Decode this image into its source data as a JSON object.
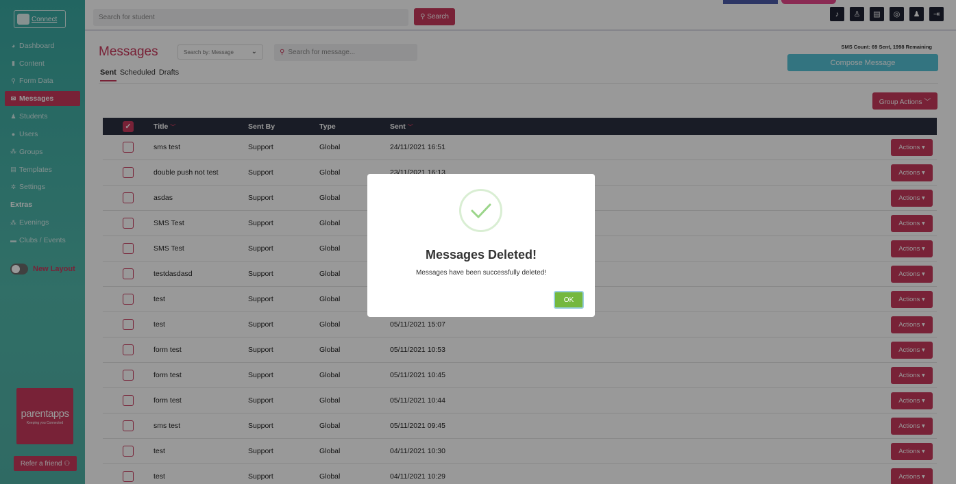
{
  "app": {
    "logo_text": "Connect",
    "search_placeholder": "Search for student",
    "search_button": "Search",
    "top_icons": [
      "bell-icon",
      "user-edit-icon",
      "id-card-icon",
      "headset-icon",
      "user-icon",
      "logout-icon"
    ]
  },
  "sidebar": {
    "items": [
      {
        "label": "Dashboard",
        "icon": "dashboard-icon",
        "glyph": "◕"
      },
      {
        "label": "Content",
        "icon": "content-icon",
        "glyph": "▮"
      },
      {
        "label": "Form Data",
        "icon": "form-data-icon",
        "glyph": "⚲"
      },
      {
        "label": "Messages",
        "icon": "envelope-icon",
        "glyph": "✉"
      },
      {
        "label": "Students",
        "icon": "student-icon",
        "glyph": "♟"
      },
      {
        "label": "Users",
        "icon": "users-icon",
        "glyph": "●"
      },
      {
        "label": "Groups",
        "icon": "groups-icon",
        "glyph": "⁂"
      },
      {
        "label": "Templates",
        "icon": "templates-icon",
        "glyph": "▤"
      },
      {
        "label": "Settings",
        "icon": "gear-icon",
        "glyph": "✲"
      }
    ],
    "extras_heading": "Extras",
    "extras": [
      {
        "label": "Evenings",
        "icon": "evenings-icon",
        "glyph": "⁂"
      },
      {
        "label": "Clubs / Events",
        "icon": "clubs-icon",
        "glyph": "▬"
      }
    ],
    "toggle_label": "New Layout",
    "brand_text": "parentapps",
    "brand_sub": "Keeping you Connected",
    "refer_label": "Refer a friend ⚇"
  },
  "header": {
    "title": "Messages",
    "search_by": "Search by: Message",
    "message_search_placeholder": "Search for message...",
    "sms_count": "SMS Count: 69 Sent, 1998 Remaining",
    "compose_label": "Compose Message",
    "tabs": [
      "Sent",
      "Scheduled",
      "Drafts"
    ],
    "group_actions": "Group Actions ﹀"
  },
  "table": {
    "columns": {
      "title": "Title",
      "sent_by": "Sent By",
      "type": "Type",
      "sent": "Sent"
    },
    "action_label": "Actions ▾",
    "rows": [
      {
        "title": "sms test",
        "sent_by": "Support",
        "type": "Global",
        "sent": "24/11/2021 16:51"
      },
      {
        "title": "double push not test",
        "sent_by": "Support",
        "type": "Global",
        "sent": "23/11/2021 16:13"
      },
      {
        "title": "asdas",
        "sent_by": "Support",
        "type": "Global",
        "sent": ""
      },
      {
        "title": "SMS Test",
        "sent_by": "Support",
        "type": "Global",
        "sent": ""
      },
      {
        "title": "SMS Test",
        "sent_by": "Support",
        "type": "Global",
        "sent": ""
      },
      {
        "title": "testdasdasd",
        "sent_by": "Support",
        "type": "Global",
        "sent": ""
      },
      {
        "title": "test",
        "sent_by": "Support",
        "type": "Global",
        "sent": ""
      },
      {
        "title": "test",
        "sent_by": "Support",
        "type": "Global",
        "sent": "05/11/2021 15:07"
      },
      {
        "title": "form test",
        "sent_by": "Support",
        "type": "Global",
        "sent": "05/11/2021 10:53"
      },
      {
        "title": "form test",
        "sent_by": "Support",
        "type": "Global",
        "sent": "05/11/2021 10:45"
      },
      {
        "title": "form test",
        "sent_by": "Support",
        "type": "Global",
        "sent": "05/11/2021 10:44"
      },
      {
        "title": "sms test",
        "sent_by": "Support",
        "type": "Global",
        "sent": "05/11/2021 09:45"
      },
      {
        "title": "test",
        "sent_by": "Support",
        "type": "Global",
        "sent": "04/11/2021 10:30"
      },
      {
        "title": "test",
        "sent_by": "Support",
        "type": "Global",
        "sent": "04/11/2021 10:29"
      }
    ]
  },
  "modal": {
    "title": "Messages Deleted!",
    "text": "Messages have been successfully deleted!",
    "ok_label": "OK"
  },
  "colors": {
    "accent": "#c83a5d",
    "sidebar": "#4fb1a6",
    "header_row": "#2a3040",
    "compose": "#55c2d6",
    "ok": "#74b83e"
  }
}
